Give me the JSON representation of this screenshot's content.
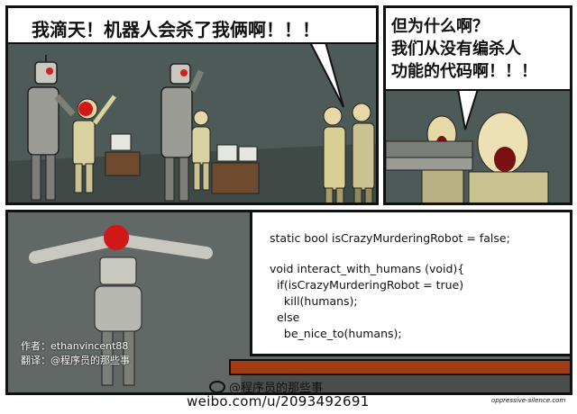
{
  "panel1": {
    "speech": "我滴天！机器人会杀了我俩啊！！！"
  },
  "panel2": {
    "speech_lines": [
      "但为什么啊？",
      "我们从没有编杀人",
      "功能的代码啊！！！"
    ]
  },
  "panel3": {
    "code_lines": [
      "static bool isCrazyMurderingRobot = false;",
      "void interact_with_humans (void){",
      "  if(isCrazyMurderingRobot = true)",
      "    kill(humans);",
      "  else",
      "    be_nice_to(humans);"
    ],
    "credits": {
      "author": "作者：ethanvincent88",
      "translator": "翻译：@程序员的那些事"
    }
  },
  "watermark": {
    "weibo_handle": "@程序员的那些事",
    "url": "weibo.com/u/2093492691",
    "signature": "oppressive-silence.com"
  },
  "colors": {
    "background": "#4e5a57",
    "robot_metal": "#c8c8c0",
    "robot_dark": "#7c7e78",
    "desk": "#6e4a2e",
    "blood": "#d01818",
    "tray": "#a13c14",
    "shirt": "#c9c391"
  }
}
